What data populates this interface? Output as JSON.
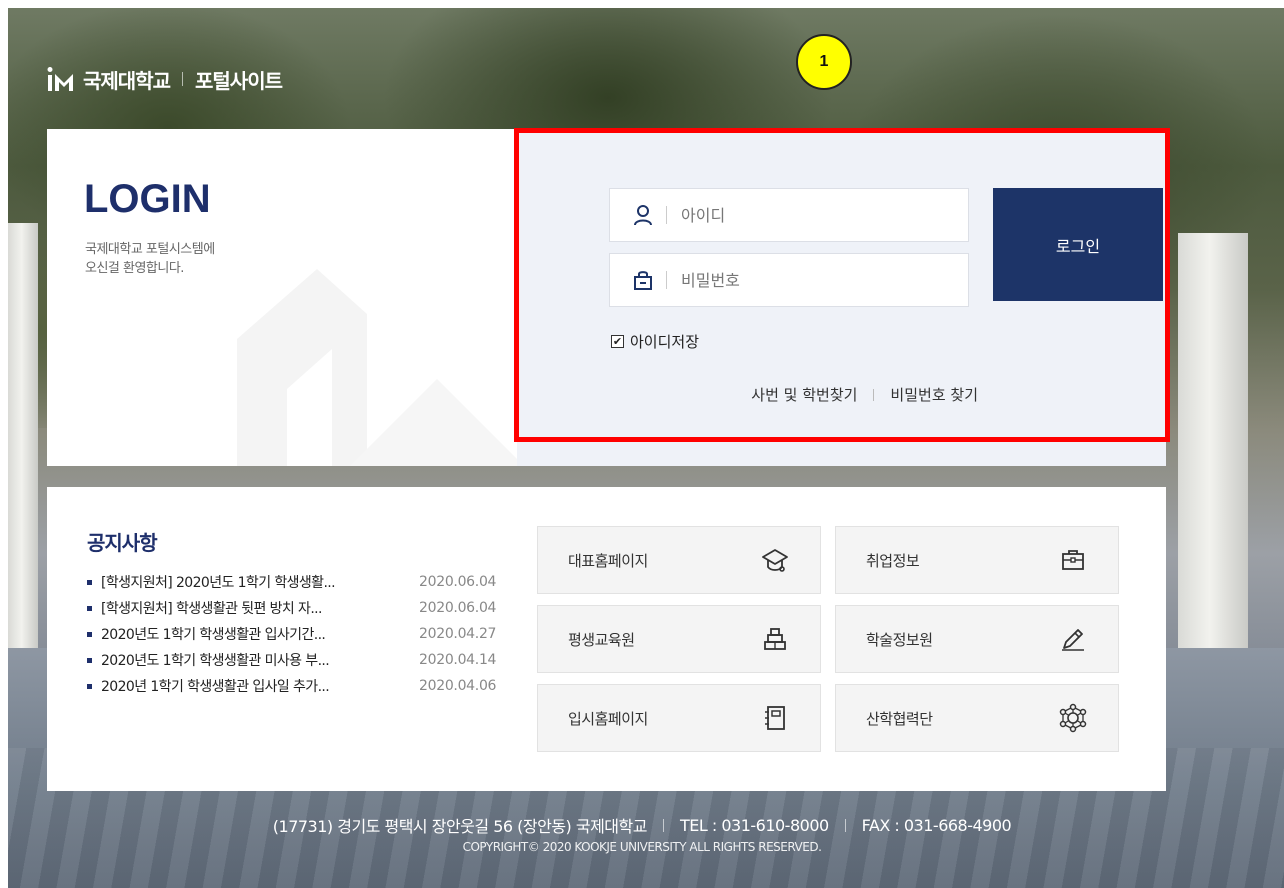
{
  "header": {
    "logo_name": "국제대학교",
    "site_name": "포털사이트"
  },
  "annotation": {
    "badge": "1"
  },
  "login": {
    "title": "LOGIN",
    "desc_line1": "국제대학교 포털시스템에",
    "desc_line2": "오신걸 환영합니다.",
    "id_placeholder": "아이디",
    "pw_placeholder": "비밀번호",
    "login_button": "로그인",
    "remember_label": "아이디저장",
    "remember_checked": true,
    "find_id_link": "사번 및 학번찾기",
    "find_pw_link": "비밀번호 찾기"
  },
  "notice": {
    "title": "공지사항",
    "items": [
      {
        "text": "[학생지원처] 2020년도 1학기 학생생활...",
        "date": "2020.06.04"
      },
      {
        "text": "[학생지원처] 학생생활관 뒷편 방치 자...",
        "date": "2020.06.04"
      },
      {
        "text": "2020년도 1학기 학생생활관 입사기간...",
        "date": "2020.04.27"
      },
      {
        "text": "2020년도 1학기 학생생활관 미사용 부...",
        "date": "2020.04.14"
      },
      {
        "text": "2020년 1학기 학생생활관 입사일 추가...",
        "date": "2020.04.06"
      }
    ]
  },
  "quick_links": [
    {
      "label": "대표홈페이지",
      "icon": "graduation-cap-icon"
    },
    {
      "label": "취업정보",
      "icon": "briefcase-icon"
    },
    {
      "label": "평생교육원",
      "icon": "books-icon"
    },
    {
      "label": "학술정보원",
      "icon": "pencil-icon"
    },
    {
      "label": "입시홈페이지",
      "icon": "notebook-icon"
    },
    {
      "label": "산학협력단",
      "icon": "network-icon"
    }
  ],
  "footer": {
    "address": "(17731) 경기도 평택시 장안웃길 56 (장안동) 국제대학교",
    "tel": "TEL : 031-610-8000",
    "fax": "FAX : 031-668-4900",
    "copyright": "COPYRIGHT© 2020 KOOKJE UNIVERSITY ALL RIGHTS RESERVED."
  },
  "colors": {
    "brand_navy": "#1d3468",
    "form_bg": "#eff2f8",
    "highlight_red": "#ff0000",
    "badge_yellow": "#ffff00"
  }
}
